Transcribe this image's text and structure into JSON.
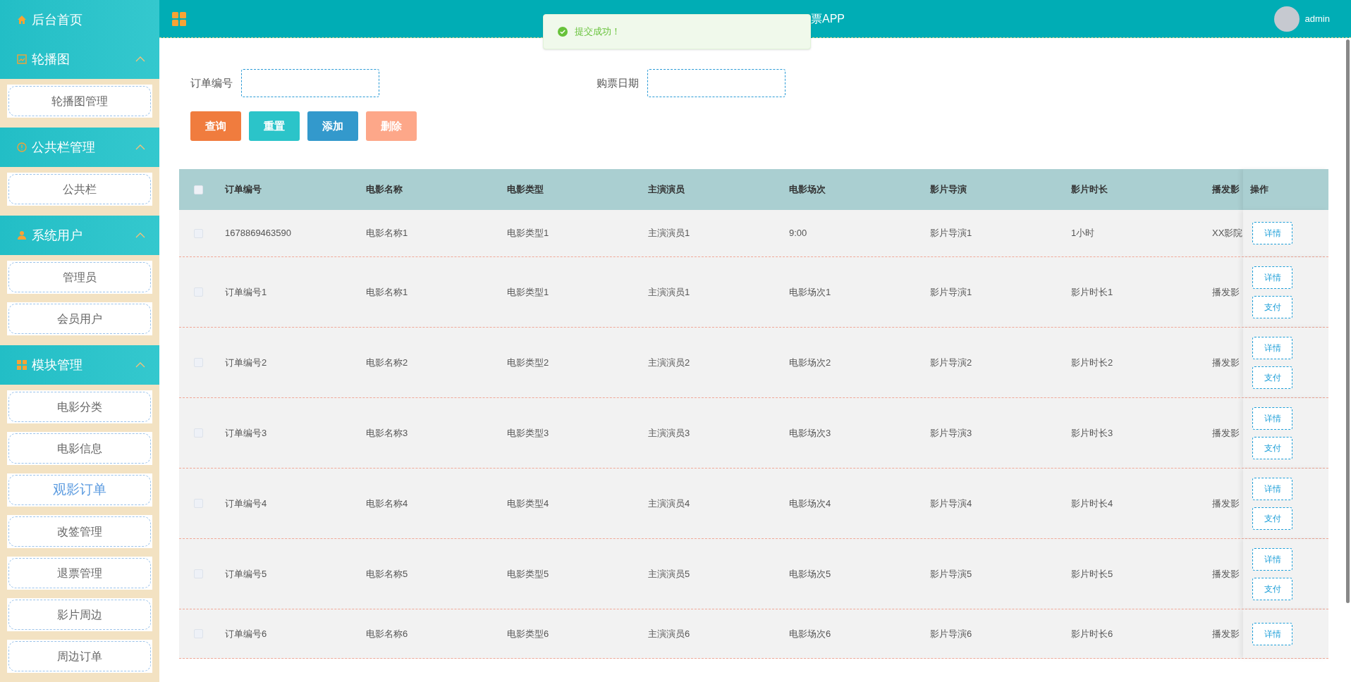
{
  "sidebar": {
    "home": {
      "label": "后台首页"
    },
    "groups": [
      {
        "title": "轮播图",
        "expanded": true,
        "items": [
          {
            "label": "轮播图管理",
            "selected": false
          }
        ]
      },
      {
        "title": "公共栏管理",
        "expanded": true,
        "items": [
          {
            "label": "公共栏",
            "selected": false
          }
        ]
      },
      {
        "title": "系统用户",
        "expanded": true,
        "items": [
          {
            "label": "管理员",
            "selected": false
          },
          {
            "label": "会员用户",
            "selected": false
          }
        ]
      },
      {
        "title": "模块管理",
        "expanded": true,
        "items": [
          {
            "label": "电影分类",
            "selected": false
          },
          {
            "label": "电影信息",
            "selected": false
          },
          {
            "label": "观影订单",
            "selected": true
          },
          {
            "label": "改签管理",
            "selected": false
          },
          {
            "label": "退票管理",
            "selected": false
          },
          {
            "label": "影片周边",
            "selected": false
          },
          {
            "label": "周边订单",
            "selected": false
          }
        ]
      }
    ]
  },
  "header": {
    "title": "票APP",
    "user": "admin"
  },
  "toast": {
    "message": "提交成功！"
  },
  "filters": [
    {
      "label": "订单编号"
    },
    {
      "label": "购票日期"
    }
  ],
  "buttons": [
    {
      "label": "查询",
      "kind": "query"
    },
    {
      "label": "重置",
      "kind": "reset"
    },
    {
      "label": "添加",
      "kind": "add"
    },
    {
      "label": "删除",
      "kind": "delete"
    }
  ],
  "table": {
    "select_all": {
      "checked": false
    },
    "columns": [
      "订单编号",
      "电影名称",
      "电影类型",
      "主演演员",
      "电影场次",
      "影片导演",
      "影片时长",
      "播发影",
      "操作"
    ],
    "rows": [
      {
        "checked": false,
        "cells": [
          "1678869463590",
          "电影名称1",
          "电影类型1",
          "主演演员1",
          "9:00",
          "影片导演1",
          "1小时",
          "XX影院"
        ],
        "actions": [
          "详情"
        ]
      },
      {
        "checked": false,
        "cells": [
          "订单编号1",
          "电影名称1",
          "电影类型1",
          "主演演员1",
          "电影场次1",
          "影片导演1",
          "影片时长1",
          "播发影"
        ],
        "actions": [
          "详情",
          "支付"
        ]
      },
      {
        "checked": false,
        "cells": [
          "订单编号2",
          "电影名称2",
          "电影类型2",
          "主演演员2",
          "电影场次2",
          "影片导演2",
          "影片时长2",
          "播发影"
        ],
        "actions": [
          "详情",
          "支付"
        ]
      },
      {
        "checked": false,
        "cells": [
          "订单编号3",
          "电影名称3",
          "电影类型3",
          "主演演员3",
          "电影场次3",
          "影片导演3",
          "影片时长3",
          "播发影"
        ],
        "actions": [
          "详情",
          "支付"
        ]
      },
      {
        "checked": false,
        "cells": [
          "订单编号4",
          "电影名称4",
          "电影类型4",
          "主演演员4",
          "电影场次4",
          "影片导演4",
          "影片时长4",
          "播发影"
        ],
        "actions": [
          "详情",
          "支付"
        ]
      },
      {
        "checked": false,
        "cells": [
          "订单编号5",
          "电影名称5",
          "电影类型5",
          "主演演员5",
          "电影场次5",
          "影片导演5",
          "影片时长5",
          "播发影"
        ],
        "actions": [
          "详情",
          "支付"
        ]
      },
      {
        "checked": false,
        "cells": [
          "订单编号6",
          "电影名称6",
          "电影类型6",
          "主演演员6",
          "电影场次6",
          "影片导演6",
          "影片时长6",
          "播发影"
        ],
        "actions": [
          "详情"
        ]
      }
    ]
  }
}
